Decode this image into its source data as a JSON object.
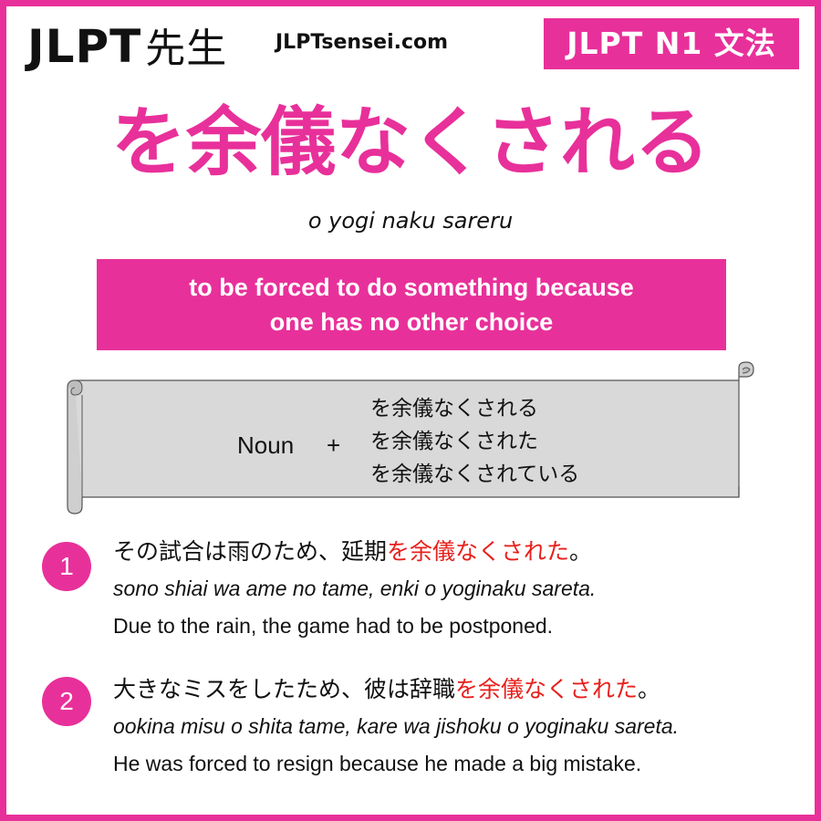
{
  "header": {
    "logo_text": "JLPT",
    "logo_sensei": "先生",
    "site": "JLPTsensei.com",
    "level_badge": "JLPT N1 文法"
  },
  "grammar": {
    "title": "を余儀なくされる",
    "romaji": "o yogi naku sareru",
    "meaning_line1": "to be forced to do something because",
    "meaning_line2": "one has no other choice"
  },
  "formation": {
    "left": "Noun",
    "plus": "+",
    "forms": [
      "を余儀なくされる",
      "を余儀なくされた",
      "を余儀なくされている"
    ]
  },
  "examples": [
    {
      "number": "1",
      "jp_before": "その試合は雨のため、延期",
      "jp_highlight": "を余儀なくされた",
      "jp_after": "。",
      "romaji": "sono shiai wa ame no tame, enki o yoginaku sareta.",
      "english": "Due to the rain, the game had to be postponed."
    },
    {
      "number": "2",
      "jp_before": "大きなミスをしたため、彼は辞職",
      "jp_highlight": "を余儀なくされた",
      "jp_after": "。",
      "romaji": "ookina misu o shita tame, kare wa jishoku o yoginaku sareta.",
      "english": "He was forced to resign because he made a big mistake."
    }
  ],
  "colors": {
    "accent": "#e8309a",
    "highlight": "#e8201c",
    "scroll_fill": "#d9d9d9"
  }
}
